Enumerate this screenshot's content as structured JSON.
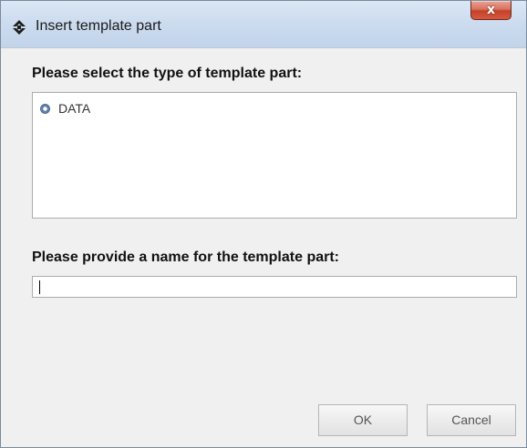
{
  "window": {
    "title": "Insert template part",
    "close_glyph": "x",
    "icon": "diamond-arrows-icon"
  },
  "type_section": {
    "label": "Please select the type of template part:",
    "options": [
      {
        "label": "DATA",
        "selected": true
      }
    ]
  },
  "name_section": {
    "label": "Please provide a name for the template part:",
    "value": ""
  },
  "buttons": {
    "ok_label": "OK",
    "cancel_label": "Cancel"
  },
  "colors": {
    "titlebar": "#cddcef",
    "close_button": "#c4412a",
    "dialog_background": "#f0f0f0",
    "radio": "#5a7fa8"
  }
}
